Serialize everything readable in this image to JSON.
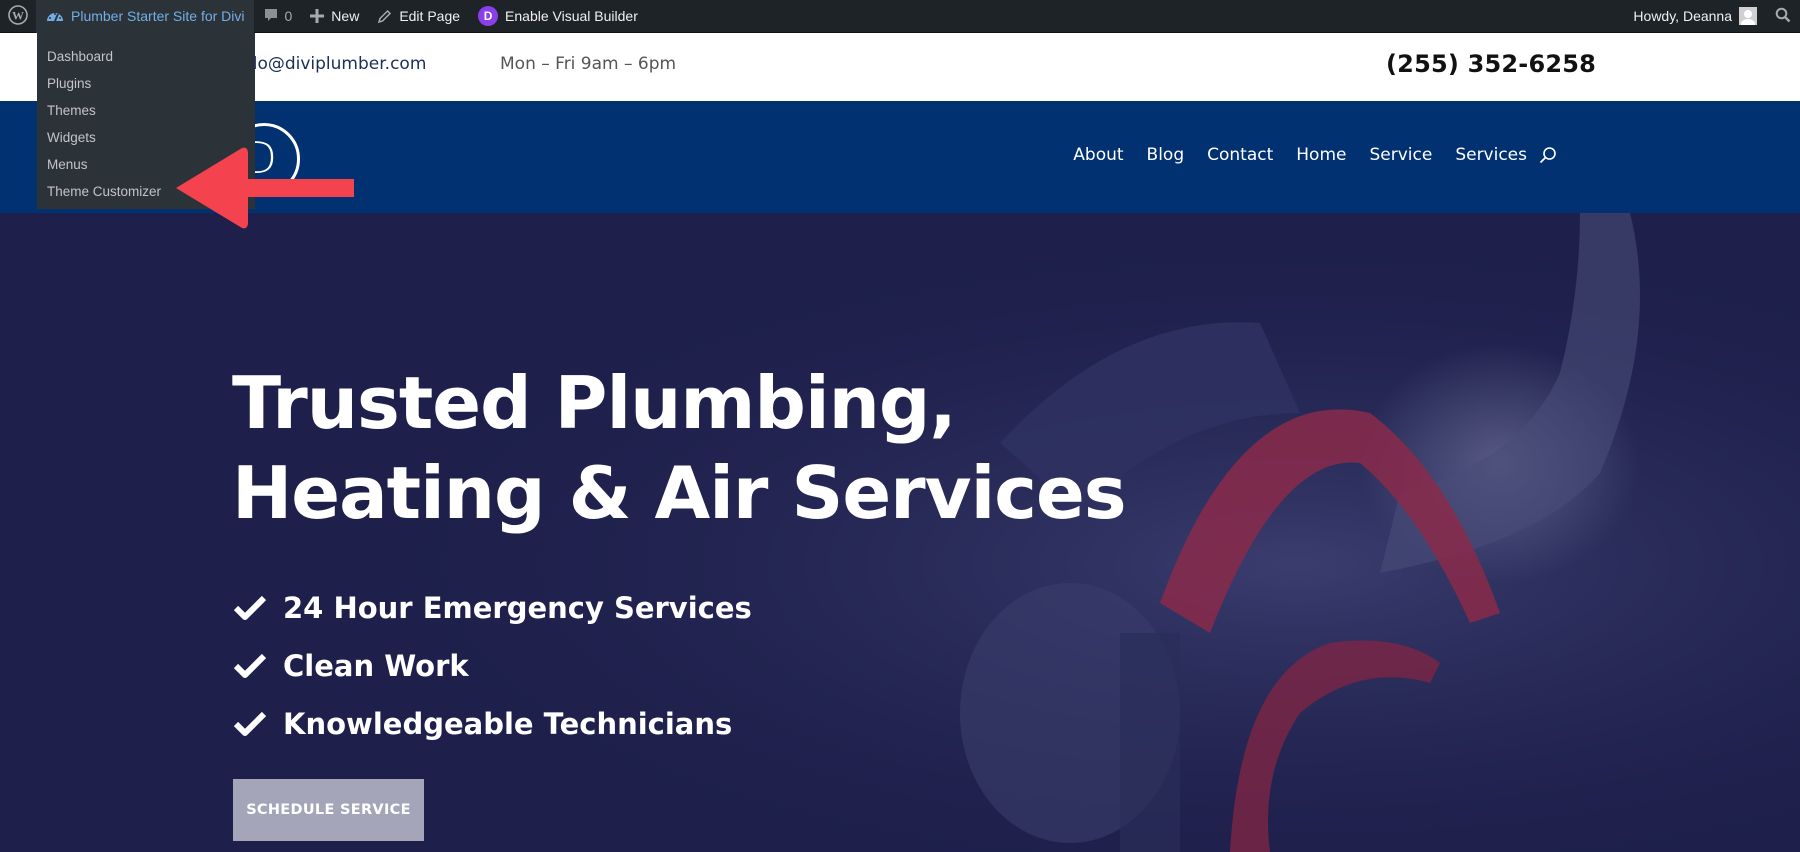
{
  "admin_bar": {
    "wp_logo_icon": "wordpress-logo-icon",
    "site_name": "Plumber Starter Site for Divi",
    "site_icon": "dashboard-gauge-icon",
    "comments_count": "0",
    "new_label": "New",
    "edit_page_label": "Edit Page",
    "visual_builder_label": "Enable Visual Builder",
    "greeting": "Howdy, Deanna",
    "search_icon": "search-icon"
  },
  "site_dropdown": {
    "items": [
      {
        "label": "Dashboard"
      },
      {
        "label": "Plugins"
      },
      {
        "label": "Themes"
      },
      {
        "label": "Widgets"
      },
      {
        "label": "Menus"
      },
      {
        "label": "Theme Customizer"
      }
    ]
  },
  "top_bar": {
    "email": "hello@diviplumber.com",
    "email_visible": "llo@diviplumber.com",
    "hours": "Mon – Fri 9am – 6pm",
    "phone": "(255) 352-6258"
  },
  "header": {
    "logo_letter": "D",
    "nav": [
      {
        "label": "About"
      },
      {
        "label": "Blog"
      },
      {
        "label": "Contact"
      },
      {
        "label": "Home"
      },
      {
        "label": "Service"
      },
      {
        "label": "Services"
      }
    ]
  },
  "hero": {
    "title_line1": "Trusted Plumbing,",
    "title_line2": "Heating & Air Services",
    "features": [
      {
        "label": "24 Hour Emergency Services"
      },
      {
        "label": "Clean Work"
      },
      {
        "label": "Knowledgeable Technicians"
      }
    ],
    "cta_label": "SCHEDULE SERVICE"
  },
  "colors": {
    "admin_bar": "#1d2327",
    "dropdown": "#2c3338",
    "header": "#013171",
    "hero_overlay": "#1e1f4b",
    "annotation_arrow": "#f4424f",
    "cta": "#a4a5b9",
    "divi_purple": "#8c3ee8"
  }
}
